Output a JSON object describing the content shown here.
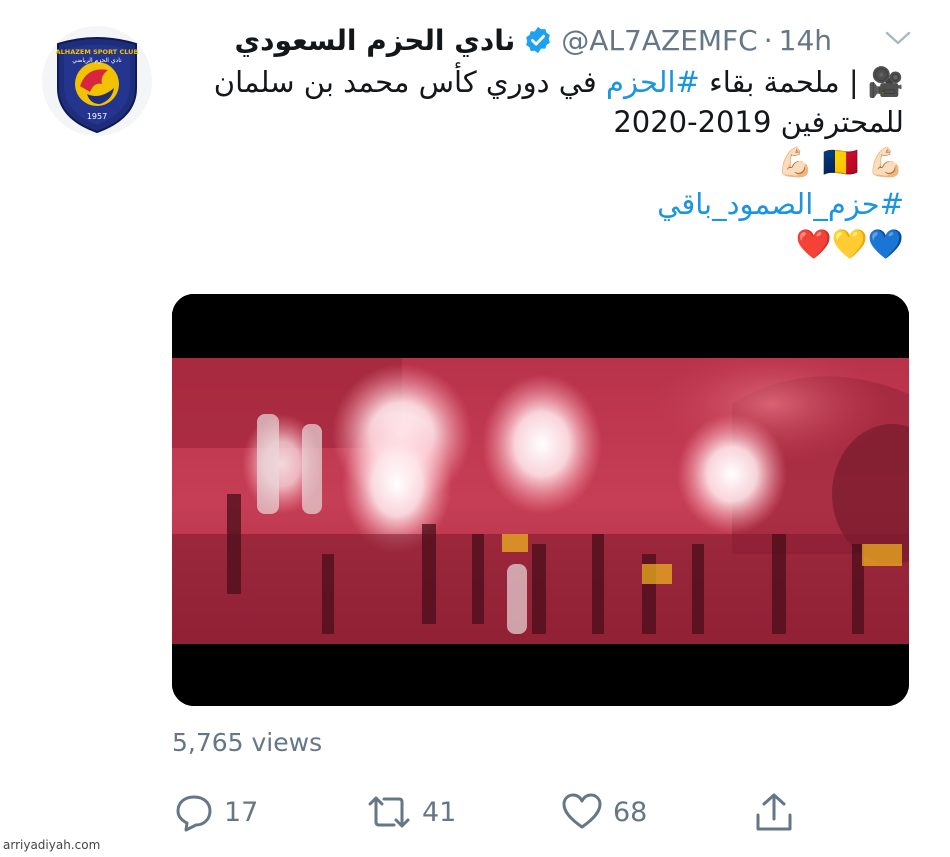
{
  "tweet": {
    "display_name": "نادي الحزم السعودي",
    "handle": "@AL7AZEMFC",
    "separator": "·",
    "time": "14h",
    "text_line1_prefix": "🎥 | ملحمة بقاء",
    "hashtag1": "#الحزم",
    "text_line1_suffix": "في دوري كأس محمد بن سلمان",
    "text_line2": "للمحترفين 2019-2020",
    "emoji_line": "💪🏻 🇹🇩 💪🏻",
    "hashtag2": "#حزم_الصمود_باقي",
    "hearts": "💙💛❤️"
  },
  "avatar": {
    "club_name": "ALHAZEM SPORT CLUB",
    "club_name_ar": "نادي الحزم الرياضي",
    "year": "1957"
  },
  "stats": {
    "views": "5,765 views",
    "replies": "17",
    "retweets": "41",
    "likes": "68"
  },
  "icons": {
    "verified": "verified-badge-icon",
    "caret": "chevron-down-icon",
    "reply": "reply-icon",
    "retweet": "retweet-icon",
    "like": "heart-icon",
    "share": "share-icon"
  },
  "colors": {
    "link": "#1b95e0",
    "muted": "#657786",
    "verified": "#1da1f2",
    "video_tint": "#c8344e"
  },
  "watermark": "arriyadiyah.com"
}
